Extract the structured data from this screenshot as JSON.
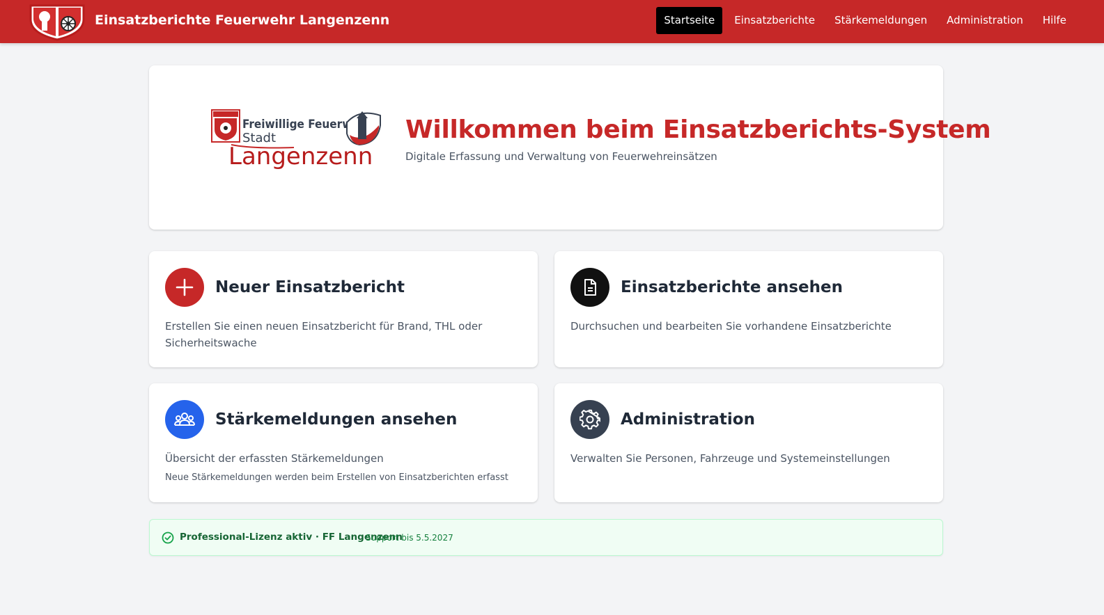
{
  "header": {
    "title": "Einsatzberichte Feuerwehr Langenzenn",
    "nav": [
      {
        "label": "Startseite",
        "active": true
      },
      {
        "label": "Einsatzberichte",
        "active": false
      },
      {
        "label": "Stärkemeldungen",
        "active": false
      },
      {
        "label": "Administration",
        "active": false
      },
      {
        "label": "Hilfe",
        "active": false
      }
    ]
  },
  "hero": {
    "logo": {
      "line1": "Freiwillige Feuerwehr",
      "line2": "Stadt",
      "line3": "Langenzenn"
    },
    "title": "Willkommen beim Einsatzberichts-System",
    "subtitle": "Digitale Erfassung und Verwaltung von Feuerwehreinsätzen"
  },
  "tiles": [
    {
      "title": "Neuer Einsatzbericht",
      "description": "Erstellen Sie einen neuen Einsatzbericht für Brand, THL oder Sicherheitswache",
      "icon": "plus-icon",
      "color": "#c62828"
    },
    {
      "title": "Einsatzberichte ansehen",
      "description": "Durchsuchen und bearbeiten Sie vorhandene Einsatzberichte",
      "icon": "document-icon",
      "color": "#111111"
    },
    {
      "title": "Stärkemeldungen ansehen",
      "description": "Übersicht der erfassten Stärkemeldungen",
      "note": "Neue Stärkemeldungen werden beim Erstellen von Einsatzberichten erfasst",
      "icon": "users-icon",
      "color": "#2563eb"
    },
    {
      "title": "Administration",
      "description": "Verwalten Sie Personen, Fahrzeuge und Systemeinstellungen",
      "icon": "gear-icon",
      "color": "#374151"
    }
  ],
  "license": {
    "text": "Professional-Lizenz aktiv · FF Langenzenn",
    "support": "Support bis 5.5.2027",
    "icon": "check-circle-icon"
  },
  "colors": {
    "brand": "#c62828",
    "background": "#f3f4f6",
    "success": "#166534"
  }
}
